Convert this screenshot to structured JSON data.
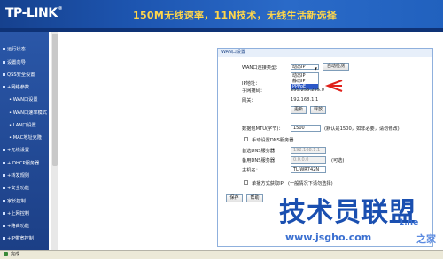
{
  "header": {
    "logo": "TP-LINK",
    "logo_reg": "®",
    "slogan": "150M无线速率，11N技术，无线生活新选择"
  },
  "sidebar": {
    "items": [
      {
        "label": "运行状态"
      },
      {
        "label": "设置向导"
      },
      {
        "label": "QSS安全设置"
      },
      {
        "label": "+网络参数"
      },
      {
        "label": "• WAN口设置"
      },
      {
        "label": "• WAN口速率模式"
      },
      {
        "label": "• LAN口设置"
      },
      {
        "label": "• MAC地址克隆"
      },
      {
        "label": "+无线设置"
      },
      {
        "label": "+ DHCP服务器"
      },
      {
        "label": "+转发规则"
      },
      {
        "label": "+安全功能"
      },
      {
        "label": "家长控制"
      },
      {
        "label": "+上网控制"
      },
      {
        "label": "+路由功能"
      },
      {
        "label": "+IP带宽控制"
      }
    ]
  },
  "panel": {
    "title": "WAN口设置",
    "conn_type_label": "WAN口连接类型：",
    "conn_type_value": "动态IP",
    "auto_detect": "自动检测",
    "dropdown_options": [
      "动态IP",
      "静态IP",
      "PPPoE"
    ],
    "ip_label": "IP地址：",
    "mask_label": "子网掩码：",
    "mask_value": "255.255.255.0",
    "gateway_label": "网关：",
    "gateway_value": "192.168.1.1",
    "renew": "更新",
    "release": "释放",
    "mtu_label": "数据包MTU(字节)：",
    "mtu_value": "1500",
    "mtu_hint": "(默认是1500，如非必要，请勿修改)",
    "manual_dns_label": "手动设置DNS服务器",
    "dns1_label": "首选DNS服务器：",
    "dns1_value": "192.168.1.1",
    "dns2_label": "备用DNS服务器：",
    "dns2_value": "0.0.0.0",
    "dns2_hint": "(可选)",
    "host_label": "主机名：",
    "host_value": "TL-WR742N",
    "unicast_label": "单播方式获取IP　(一般情况下请勿选择)",
    "save": "保存",
    "help": "帮助"
  },
  "watermark": {
    "main": "技术员联盟",
    "url": "www.jsgho.com",
    "side": "1.ne",
    "home": "之家"
  },
  "statusbar": {
    "text": "完成"
  },
  "colors": {
    "header_blue": "#1d55b0",
    "slogan_yellow": "#ffd64a",
    "sidebar_blue": "#2a57a8",
    "arrow_red": "#e0201a",
    "watermark_blue": "#1a4fb0"
  }
}
